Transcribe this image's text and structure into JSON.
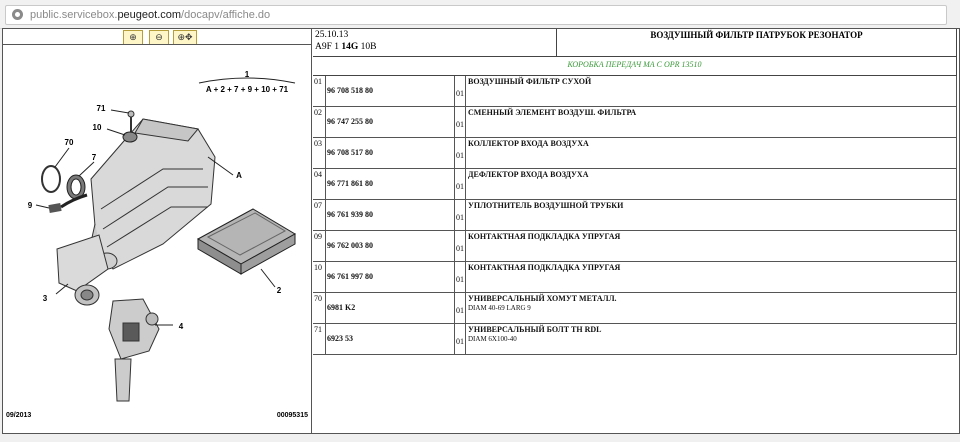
{
  "browser": {
    "url_prefix": "public.servicebox.",
    "url_domain": "peugeot.com",
    "url_path": "/docapv/affiche.do"
  },
  "zoom_tools": [
    {
      "name": "zoom-in",
      "symbol": "⊕"
    },
    {
      "name": "zoom-out",
      "symbol": "⊖"
    },
    {
      "name": "zoom-fit",
      "symbol": "⊕✥"
    }
  ],
  "diagram": {
    "callouts": [
      "71",
      "10",
      "70",
      "7",
      "9",
      "3",
      "1",
      "A",
      "2",
      "4"
    ],
    "formula": "A + 2 + 7 + 9 + 10 + 71",
    "footer_left": "09/2013",
    "footer_right": "00095315"
  },
  "header": {
    "date": "25.10.13",
    "model_prefix": "A9F 1 ",
    "model_bold": "14G",
    "model_suffix": " 10B",
    "title": "ВОЗДУШНЫЙ ФИЛЬТР ПАТРУБОК РЕЗОНАТОР",
    "subtitle": "КОРОБКА ПЕРЕДАЧ МА С OPR 13510"
  },
  "parts": [
    {
      "item": "01",
      "ref": "96 708 518 80",
      "qty": "01",
      "name": "ВОЗДУШНЫЙ ФИЛЬТР СУХОЙ",
      "note": ""
    },
    {
      "item": "02",
      "ref": "96 747 255 80",
      "qty": "01",
      "name": "СМЕННЫЙ ЭЛЕМЕНТ ВОЗДУШ. ФИЛЬТРА",
      "note": ""
    },
    {
      "item": "03",
      "ref": "96 708 517 80",
      "qty": "01",
      "name": "КОЛЛЕКТОР ВХОДА ВОЗДУХА",
      "note": ""
    },
    {
      "item": "04",
      "ref": "96 771 861 80",
      "qty": "01",
      "name": "ДЕФЛЕКТОР ВХОДА ВОЗДУХА",
      "note": ""
    },
    {
      "item": "07",
      "ref": "96 761 939 80",
      "qty": "01",
      "name": "УПЛОТНИТЕЛЬ ВОЗДУШНОЙ ТРУБКИ",
      "note": ""
    },
    {
      "item": "09",
      "ref": "96 762 003 80",
      "qty": "01",
      "name": "КОНТАКТНАЯ ПОДКЛАДКА УПРУГАЯ",
      "note": ""
    },
    {
      "item": "10",
      "ref": "96 761 997 80",
      "qty": "01",
      "name": "КОНТАКТНАЯ ПОДКЛАДКА УПРУГАЯ",
      "note": ""
    },
    {
      "item": "70",
      "ref": "6981 K2",
      "qty": "01",
      "name": "УНИВЕРСАЛЬНЫЙ ХОМУТ МЕТАЛЛ.",
      "note": "DIAM 40-69 LARG 9"
    },
    {
      "item": "71",
      "ref": "6923 53",
      "qty": "01",
      "name": "УНИВЕРСАЛЬНЫЙ БОЛТ TH RDL",
      "note": "DIAM 6X100-40"
    }
  ],
  "colors": {
    "subtitle": "#3a9a3a",
    "zoom_bg": "#fff6c8"
  }
}
